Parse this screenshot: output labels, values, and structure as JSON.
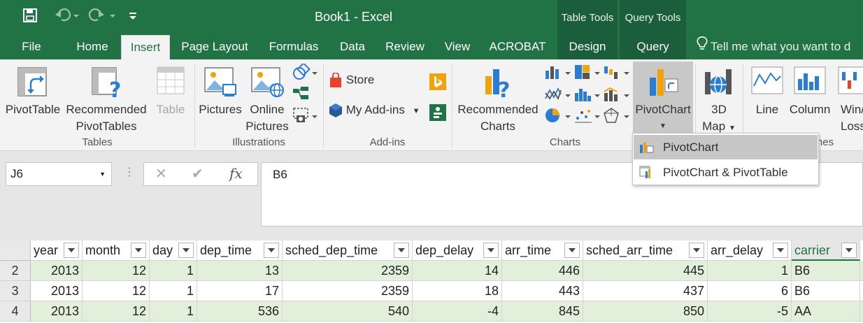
{
  "window": {
    "title": "Book1  -  Excel"
  },
  "quick_access": {
    "save_icon": "save-icon",
    "undo_icon": "undo-icon",
    "redo_icon": "redo-icon",
    "customize_icon": "customize-qat-icon"
  },
  "context_tabs": {
    "table_tools": "Table Tools",
    "query_tools": "Query Tools"
  },
  "tabs": [
    {
      "label": "File"
    },
    {
      "label": "Home"
    },
    {
      "label": "Insert"
    },
    {
      "label": "Page Layout"
    },
    {
      "label": "Formulas"
    },
    {
      "label": "Data"
    },
    {
      "label": "Review"
    },
    {
      "label": "View"
    },
    {
      "label": "ACROBAT"
    },
    {
      "label": "Design"
    },
    {
      "label": "Query"
    }
  ],
  "active_tab": "Insert",
  "tell_me": {
    "placeholder": "Tell me what you want to d"
  },
  "ribbon": {
    "tables": {
      "pivottable": "PivotTable",
      "recommended1": "Recommended",
      "recommended2": "PivotTables",
      "table": "Table",
      "group": "Tables"
    },
    "illustrations": {
      "pictures": "Pictures",
      "online1": "Online",
      "online2": "Pictures",
      "group": "Illustrations"
    },
    "addins": {
      "store": "Store",
      "my_addins": "My Add-ins",
      "group": "Add-ins"
    },
    "charts": {
      "recommended1": "Recommended",
      "recommended2": "Charts",
      "pivotchart": "PivotChart",
      "map1": "3D",
      "map2": "Map",
      "group": "Charts"
    },
    "sparklines": {
      "line": "Line",
      "column": "Column",
      "winloss1": "Win/",
      "winloss2": "Loss",
      "group_partial": "nes"
    }
  },
  "dropdown": {
    "items": [
      "PivotChart",
      "PivotChart & PivotTable"
    ]
  },
  "formula_bar": {
    "name_box": "J6",
    "cancel": "✕",
    "enter": "✔",
    "fx": "fx",
    "value": "B6"
  },
  "sheet": {
    "headers": [
      "year",
      "month",
      "day",
      "dep_time",
      "sched_dep_time",
      "dep_delay",
      "arr_time",
      "sched_arr_time",
      "arr_delay",
      "carrier"
    ],
    "rows": [
      {
        "num": "2",
        "cells": [
          "2013",
          "12",
          "1",
          "13",
          "2359",
          "14",
          "446",
          "445",
          "1",
          "B6"
        ]
      },
      {
        "num": "3",
        "cells": [
          "2013",
          "12",
          "1",
          "17",
          "2359",
          "18",
          "443",
          "437",
          "6",
          "B6"
        ]
      },
      {
        "num": "4",
        "cells": [
          "2013",
          "12",
          "1",
          "536",
          "540",
          "-4",
          "845",
          "850",
          "-5",
          "AA"
        ]
      }
    ]
  },
  "colors": {
    "accent": "#217346",
    "band": "#e2efda",
    "selected_header": "#217346"
  }
}
